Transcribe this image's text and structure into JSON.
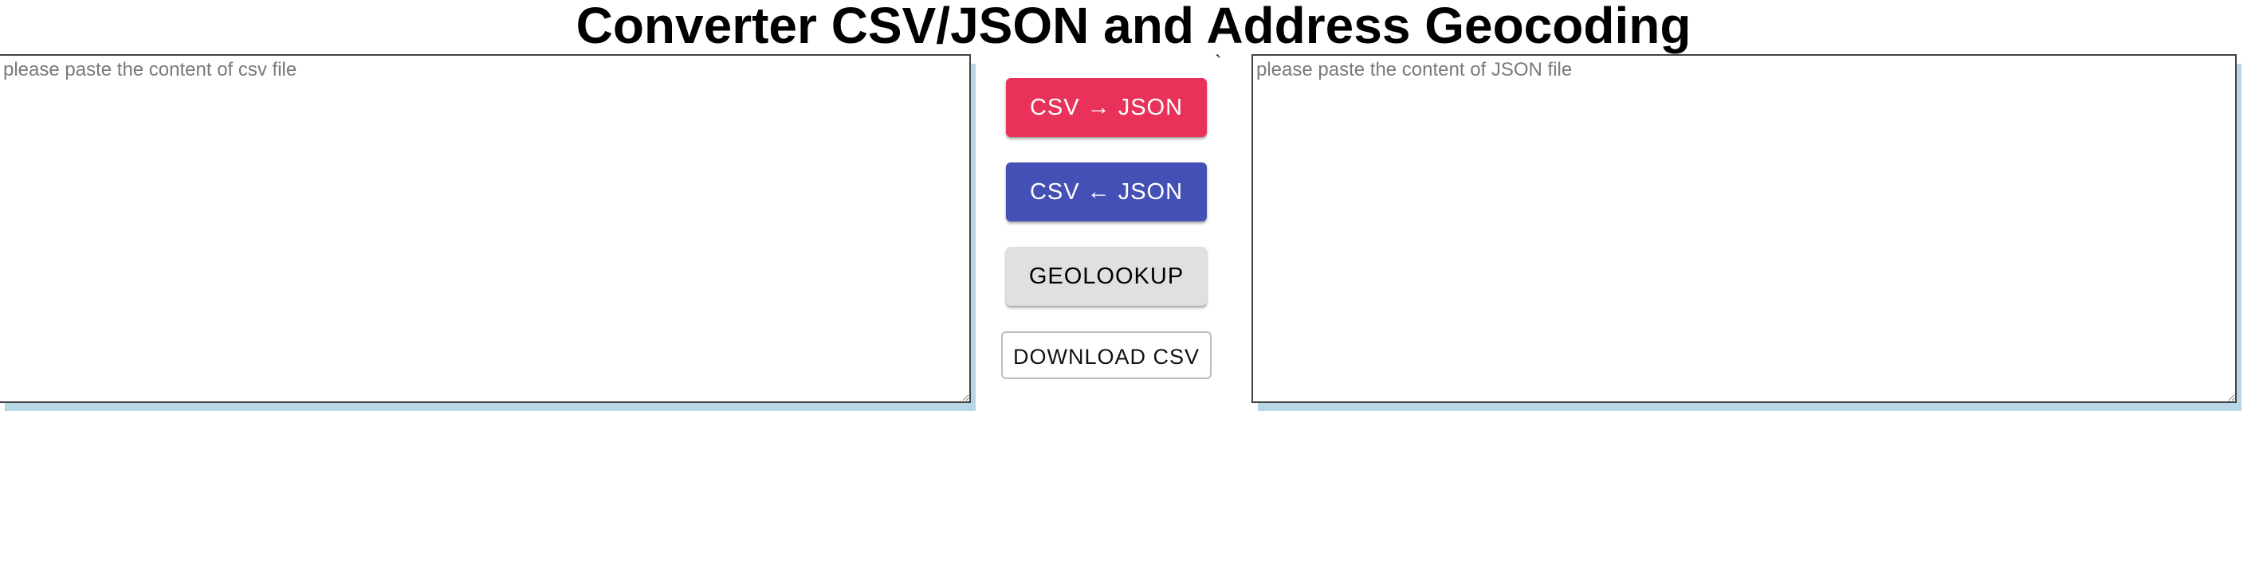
{
  "title": "Converter CSV/JSON and Address Geocoding",
  "csv_pane": {
    "placeholder": "please paste the content of csv file",
    "value": ""
  },
  "json_pane": {
    "placeholder": "please paste the content of JSON file",
    "value": ""
  },
  "buttons": {
    "csv_to_json": "CSV → JSON",
    "json_to_csv": "CSV ← JSON",
    "geolookup": "GEOLOOKUP",
    "download_csv": "DOWNLOAD CSV"
  },
  "stray_mark": "`",
  "colors": {
    "csv_to_json_bg": "#e8325a",
    "json_to_csv_bg": "#4450b5",
    "geolookup_bg": "#e0e0e0",
    "pane_shadow": "#b7d7e6"
  }
}
